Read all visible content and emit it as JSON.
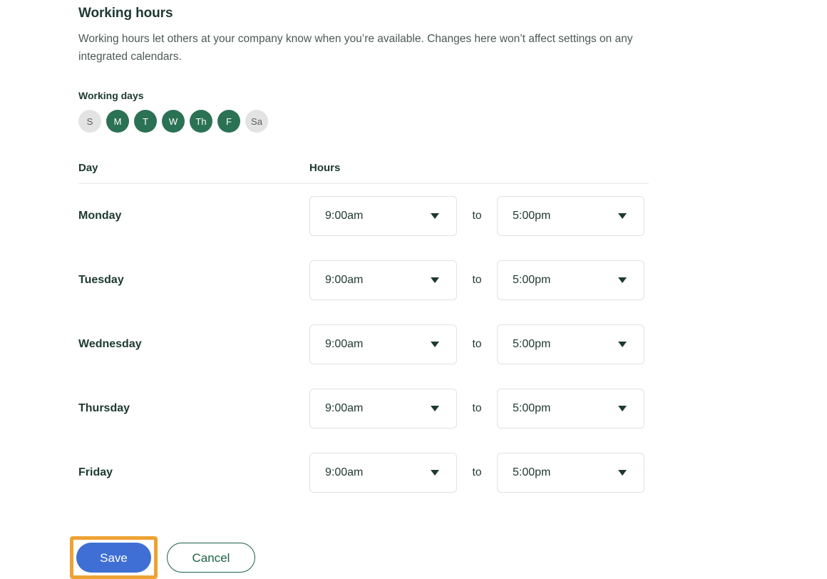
{
  "section": {
    "title": "Working hours",
    "description": "Working hours let others at your company know when you’re available. Changes here won’t affect settings on any integrated calendars."
  },
  "working_days": {
    "label": "Working days",
    "chips": [
      {
        "label": "S",
        "selected": false
      },
      {
        "label": "M",
        "selected": true
      },
      {
        "label": "T",
        "selected": true
      },
      {
        "label": "W",
        "selected": true
      },
      {
        "label": "Th",
        "selected": true
      },
      {
        "label": "F",
        "selected": true
      },
      {
        "label": "Sa",
        "selected": false
      }
    ]
  },
  "table": {
    "headers": {
      "day": "Day",
      "hours": "Hours"
    },
    "to_label": "to",
    "rows": [
      {
        "day": "Monday",
        "start": "9:00am",
        "end": "5:00pm"
      },
      {
        "day": "Tuesday",
        "start": "9:00am",
        "end": "5:00pm"
      },
      {
        "day": "Wednesday",
        "start": "9:00am",
        "end": "5:00pm"
      },
      {
        "day": "Thursday",
        "start": "9:00am",
        "end": "5:00pm"
      },
      {
        "day": "Friday",
        "start": "9:00am",
        "end": "5:00pm"
      }
    ]
  },
  "actions": {
    "save_label": "Save",
    "cancel_label": "Cancel"
  },
  "colors": {
    "selected_day": "#2b7255",
    "unselected_day": "#e3e3e3",
    "save_blue": "#3f6fd4",
    "focus_orange": "#eea233",
    "cancel_green": "#1e6145",
    "text_dark": "#1e3932"
  }
}
